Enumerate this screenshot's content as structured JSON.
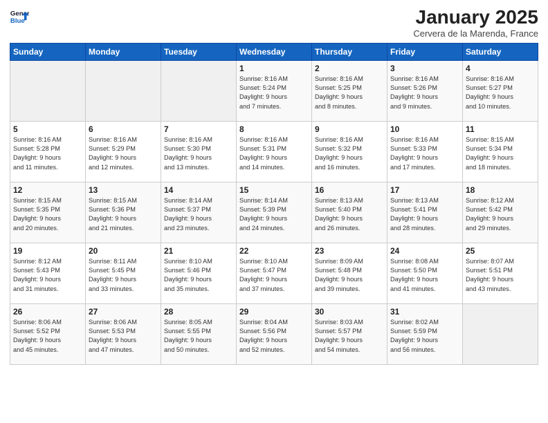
{
  "header": {
    "logo_line1": "General",
    "logo_line2": "Blue",
    "month": "January 2025",
    "location": "Cervera de la Marenda, France"
  },
  "days_of_week": [
    "Sunday",
    "Monday",
    "Tuesday",
    "Wednesday",
    "Thursday",
    "Friday",
    "Saturday"
  ],
  "weeks": [
    [
      {
        "day": "",
        "info": ""
      },
      {
        "day": "",
        "info": ""
      },
      {
        "day": "",
        "info": ""
      },
      {
        "day": "1",
        "info": "Sunrise: 8:16 AM\nSunset: 5:24 PM\nDaylight: 9 hours\nand 7 minutes."
      },
      {
        "day": "2",
        "info": "Sunrise: 8:16 AM\nSunset: 5:25 PM\nDaylight: 9 hours\nand 8 minutes."
      },
      {
        "day": "3",
        "info": "Sunrise: 8:16 AM\nSunset: 5:26 PM\nDaylight: 9 hours\nand 9 minutes."
      },
      {
        "day": "4",
        "info": "Sunrise: 8:16 AM\nSunset: 5:27 PM\nDaylight: 9 hours\nand 10 minutes."
      }
    ],
    [
      {
        "day": "5",
        "info": "Sunrise: 8:16 AM\nSunset: 5:28 PM\nDaylight: 9 hours\nand 11 minutes."
      },
      {
        "day": "6",
        "info": "Sunrise: 8:16 AM\nSunset: 5:29 PM\nDaylight: 9 hours\nand 12 minutes."
      },
      {
        "day": "7",
        "info": "Sunrise: 8:16 AM\nSunset: 5:30 PM\nDaylight: 9 hours\nand 13 minutes."
      },
      {
        "day": "8",
        "info": "Sunrise: 8:16 AM\nSunset: 5:31 PM\nDaylight: 9 hours\nand 14 minutes."
      },
      {
        "day": "9",
        "info": "Sunrise: 8:16 AM\nSunset: 5:32 PM\nDaylight: 9 hours\nand 16 minutes."
      },
      {
        "day": "10",
        "info": "Sunrise: 8:16 AM\nSunset: 5:33 PM\nDaylight: 9 hours\nand 17 minutes."
      },
      {
        "day": "11",
        "info": "Sunrise: 8:15 AM\nSunset: 5:34 PM\nDaylight: 9 hours\nand 18 minutes."
      }
    ],
    [
      {
        "day": "12",
        "info": "Sunrise: 8:15 AM\nSunset: 5:35 PM\nDaylight: 9 hours\nand 20 minutes."
      },
      {
        "day": "13",
        "info": "Sunrise: 8:15 AM\nSunset: 5:36 PM\nDaylight: 9 hours\nand 21 minutes."
      },
      {
        "day": "14",
        "info": "Sunrise: 8:14 AM\nSunset: 5:37 PM\nDaylight: 9 hours\nand 23 minutes."
      },
      {
        "day": "15",
        "info": "Sunrise: 8:14 AM\nSunset: 5:39 PM\nDaylight: 9 hours\nand 24 minutes."
      },
      {
        "day": "16",
        "info": "Sunrise: 8:13 AM\nSunset: 5:40 PM\nDaylight: 9 hours\nand 26 minutes."
      },
      {
        "day": "17",
        "info": "Sunrise: 8:13 AM\nSunset: 5:41 PM\nDaylight: 9 hours\nand 28 minutes."
      },
      {
        "day": "18",
        "info": "Sunrise: 8:12 AM\nSunset: 5:42 PM\nDaylight: 9 hours\nand 29 minutes."
      }
    ],
    [
      {
        "day": "19",
        "info": "Sunrise: 8:12 AM\nSunset: 5:43 PM\nDaylight: 9 hours\nand 31 minutes."
      },
      {
        "day": "20",
        "info": "Sunrise: 8:11 AM\nSunset: 5:45 PM\nDaylight: 9 hours\nand 33 minutes."
      },
      {
        "day": "21",
        "info": "Sunrise: 8:10 AM\nSunset: 5:46 PM\nDaylight: 9 hours\nand 35 minutes."
      },
      {
        "day": "22",
        "info": "Sunrise: 8:10 AM\nSunset: 5:47 PM\nDaylight: 9 hours\nand 37 minutes."
      },
      {
        "day": "23",
        "info": "Sunrise: 8:09 AM\nSunset: 5:48 PM\nDaylight: 9 hours\nand 39 minutes."
      },
      {
        "day": "24",
        "info": "Sunrise: 8:08 AM\nSunset: 5:50 PM\nDaylight: 9 hours\nand 41 minutes."
      },
      {
        "day": "25",
        "info": "Sunrise: 8:07 AM\nSunset: 5:51 PM\nDaylight: 9 hours\nand 43 minutes."
      }
    ],
    [
      {
        "day": "26",
        "info": "Sunrise: 8:06 AM\nSunset: 5:52 PM\nDaylight: 9 hours\nand 45 minutes."
      },
      {
        "day": "27",
        "info": "Sunrise: 8:06 AM\nSunset: 5:53 PM\nDaylight: 9 hours\nand 47 minutes."
      },
      {
        "day": "28",
        "info": "Sunrise: 8:05 AM\nSunset: 5:55 PM\nDaylight: 9 hours\nand 50 minutes."
      },
      {
        "day": "29",
        "info": "Sunrise: 8:04 AM\nSunset: 5:56 PM\nDaylight: 9 hours\nand 52 minutes."
      },
      {
        "day": "30",
        "info": "Sunrise: 8:03 AM\nSunset: 5:57 PM\nDaylight: 9 hours\nand 54 minutes."
      },
      {
        "day": "31",
        "info": "Sunrise: 8:02 AM\nSunset: 5:59 PM\nDaylight: 9 hours\nand 56 minutes."
      },
      {
        "day": "",
        "info": ""
      }
    ]
  ]
}
